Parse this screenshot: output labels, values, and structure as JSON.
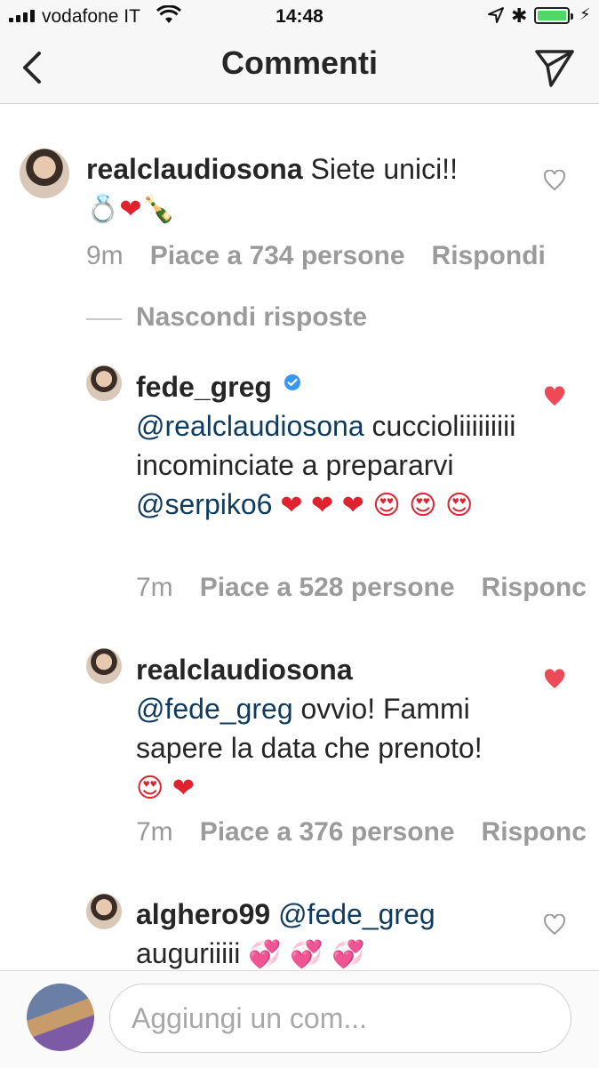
{
  "status_bar": {
    "carrier": "vodafone IT",
    "time": "14:48",
    "battery_level": 1.0,
    "charging": true
  },
  "header": {
    "title": "Commenti",
    "back_icon": "chevron-left-icon",
    "send_icon": "paper-plane-icon"
  },
  "comments": [
    {
      "username": "realclaudiosona",
      "text": "Siete unici!!",
      "emoji": "💍❤🍾",
      "time": "9m",
      "likes": "Piace a 734 persone",
      "reply_label": "Rispondi",
      "liked": false
    },
    {
      "username": "fede_greg",
      "verified": true,
      "mention": "@realclaudiosona",
      "text": "cuccioliiiiiiiii incominciate a prepararvi",
      "mention2": "@serpiko6",
      "emoji": "❤ ❤ ❤ 😍 😍 😍",
      "time": "7m",
      "likes": "Piace a 528 persone",
      "reply_label": "Risponc",
      "liked": true
    },
    {
      "username": "realclaudiosona",
      "mention": "@fede_greg",
      "text": "ovvio! Fammi sapere la data che prenoto!",
      "emoji": "😍 ❤",
      "time": "7m",
      "likes": "Piace a 376 persone",
      "reply_label": "Risponc",
      "liked": true
    },
    {
      "username": "alghero99",
      "mention": "@fede_greg",
      "text": "auguriiiii",
      "emoji": "💞 💞 💞",
      "liked": false
    }
  ],
  "hide_replies": "Nascondi risposte",
  "composer": {
    "placeholder": "Aggiungi un com..."
  },
  "colors": {
    "heart_liked": "#ed4956",
    "mention": "#0f3b5f",
    "muted": "#9b9b9b",
    "verified": "#3897f0"
  }
}
